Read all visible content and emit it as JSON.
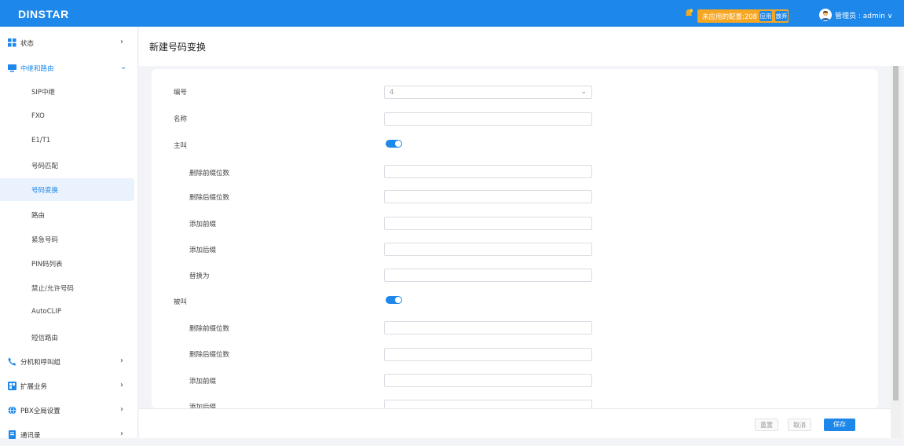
{
  "header": {
    "logo": "DINSTAR",
    "pending_text": "未应用的配置:208",
    "apply_label": "应用",
    "discard_label": "放弃",
    "user_label": "管理员 : admin"
  },
  "sidebar": {
    "items": [
      {
        "label": "状态",
        "icon": "grid-icon"
      },
      {
        "label": "中继和路由",
        "icon": "monitor-icon"
      },
      {
        "label": "分机和呼叫组",
        "icon": "phone-icon"
      },
      {
        "label": "扩展业务",
        "icon": "apps-icon"
      },
      {
        "label": "PBX全局设置",
        "icon": "globe-icon"
      },
      {
        "label": "通讯录",
        "icon": "book-icon"
      }
    ],
    "subitems": [
      "SIP中继",
      "FXO",
      "E1/T1",
      "号码匹配",
      "号码变换",
      "路由",
      "紧急号码",
      "PIN码列表",
      "禁止/允许号码",
      "AutoCLIP",
      "短信路由"
    ]
  },
  "page": {
    "title": "新建号码变换"
  },
  "form": {
    "number_label": "编号",
    "number_value": "4",
    "name_label": "名称",
    "caller_label": "主叫",
    "callee_label": "被叫",
    "del_prefix_label": "删除前缀位数",
    "del_suffix_label": "删除后缀位数",
    "add_prefix_label": "添加前缀",
    "add_suffix_label": "添加后缀",
    "replace_label": "替换为",
    "caller_enabled": true,
    "callee_enabled": true
  },
  "footer": {
    "reset_label": "重置",
    "cancel_label": "取消",
    "save_label": "保存"
  },
  "colors": {
    "primary": "#1d87ea",
    "pending": "#f5a623"
  }
}
